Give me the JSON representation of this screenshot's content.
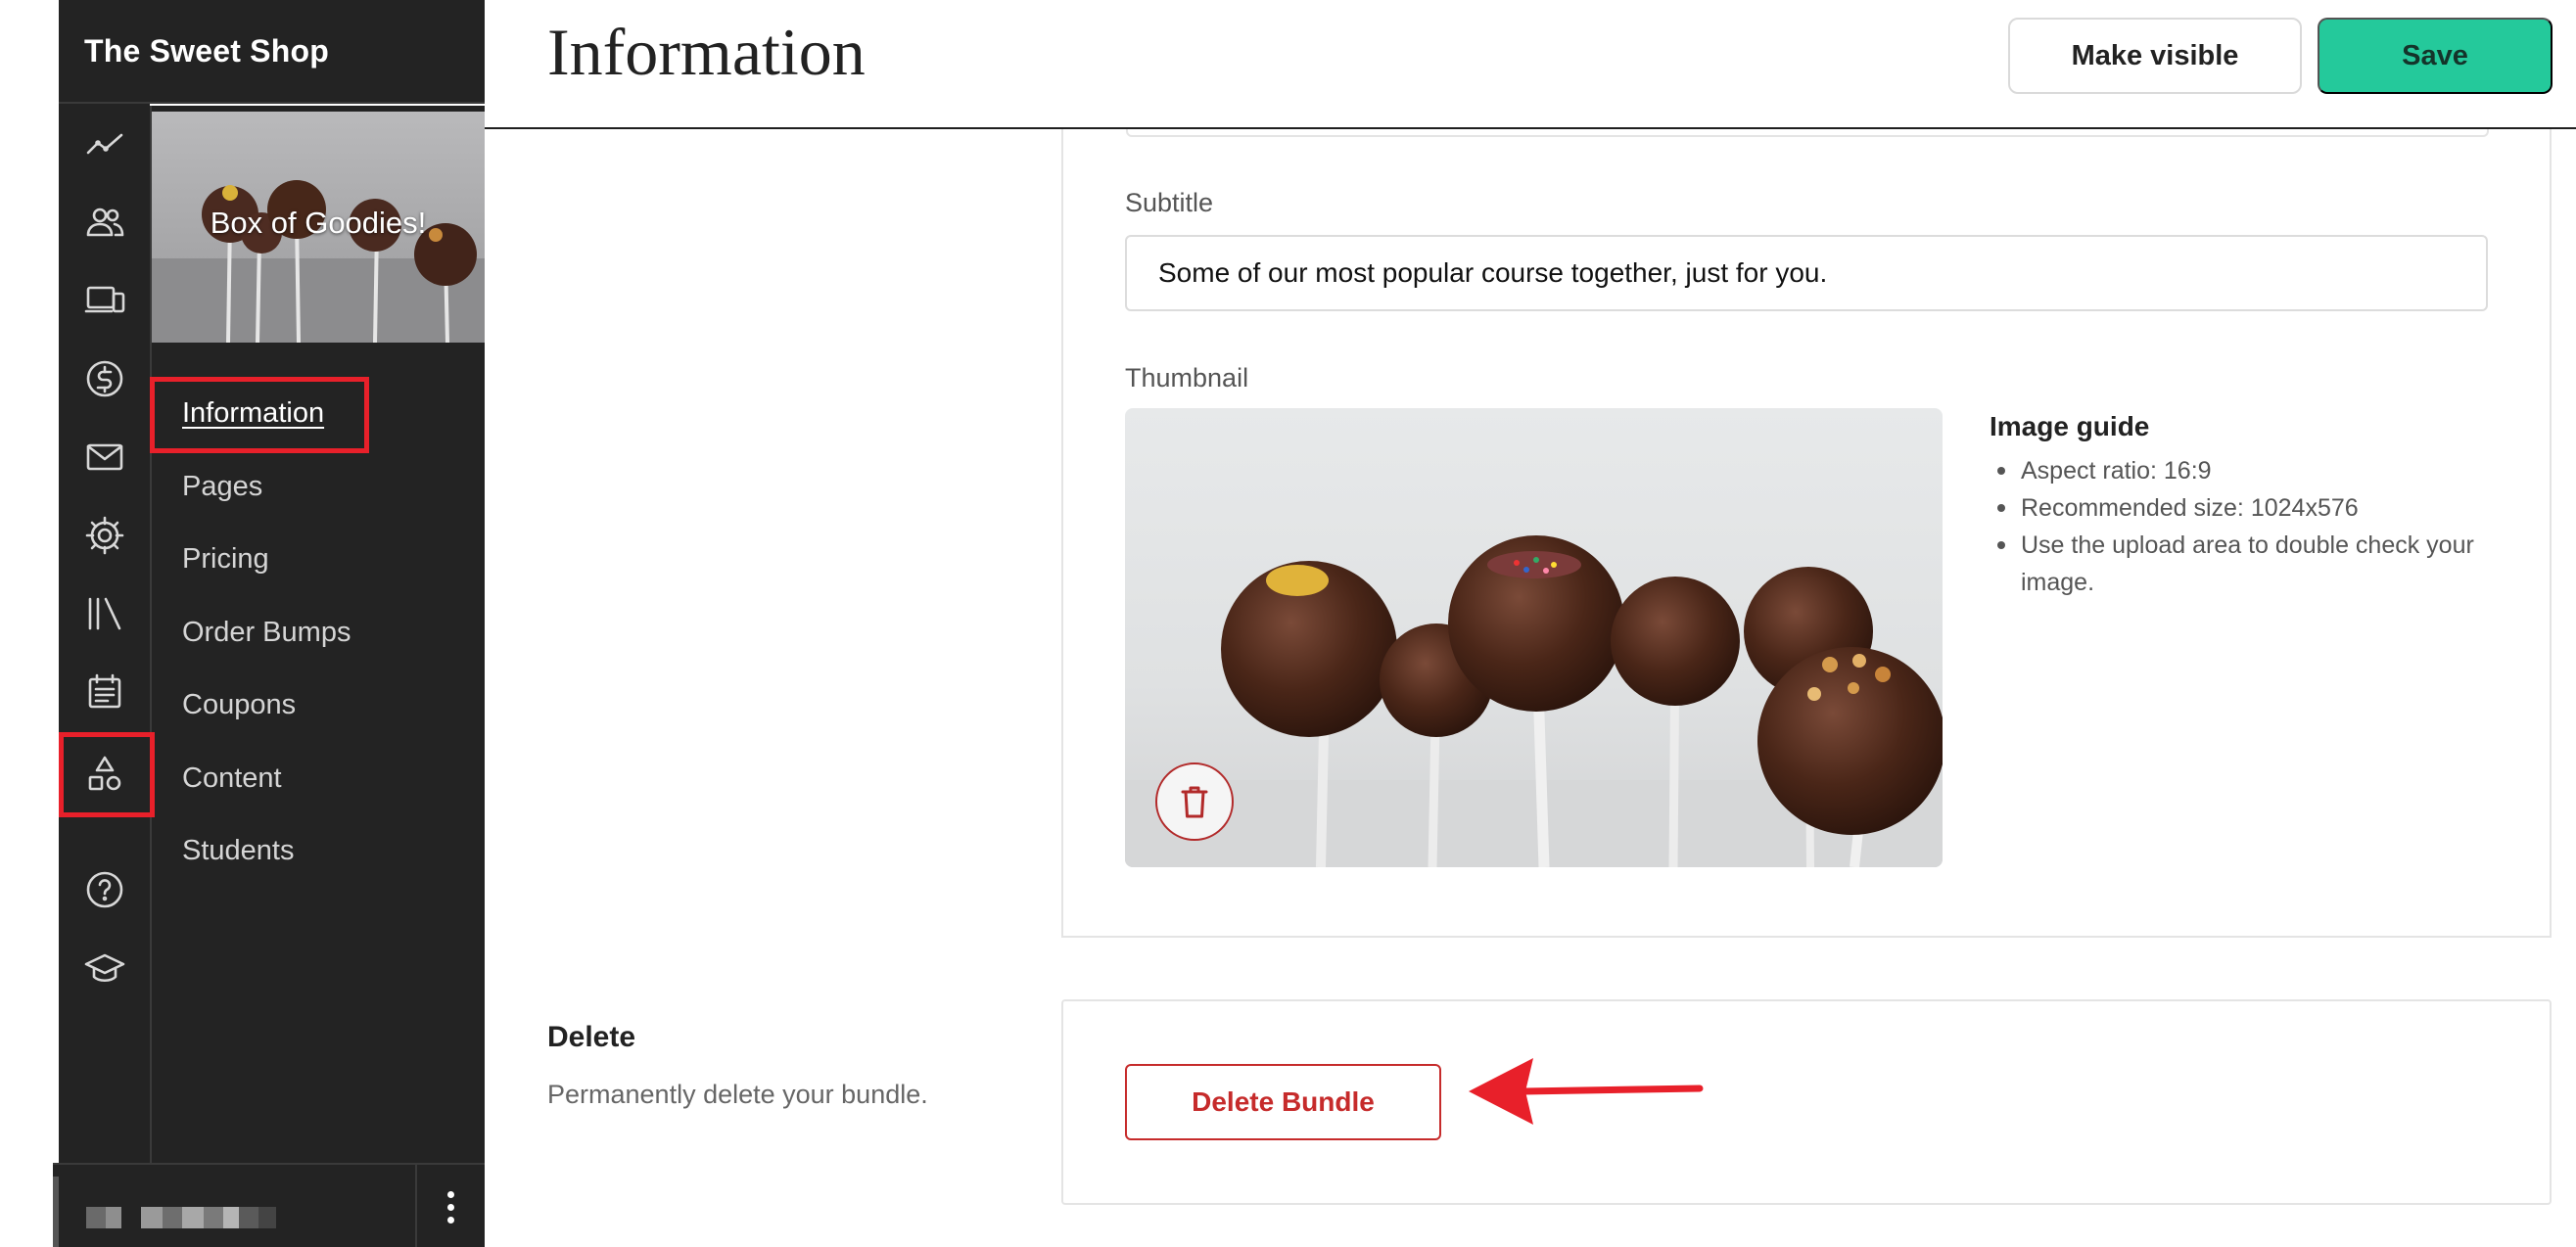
{
  "app": {
    "shop_name": "The Sweet Shop"
  },
  "rail": {
    "icons": [
      "analytics-icon",
      "users-icon",
      "devices-icon",
      "dollar-icon",
      "mail-icon",
      "gear-icon",
      "library-icon",
      "calendar-icon",
      "shapes-icon",
      "help-icon",
      "graduation-cap-icon"
    ],
    "active": "shapes-icon"
  },
  "bundle": {
    "title": "Box of Goodies!"
  },
  "subnav": {
    "items": [
      {
        "label": "Information",
        "active": true
      },
      {
        "label": "Pages"
      },
      {
        "label": "Pricing"
      },
      {
        "label": "Order Bumps"
      },
      {
        "label": "Coupons"
      },
      {
        "label": "Content"
      },
      {
        "label": "Students"
      }
    ]
  },
  "header": {
    "title": "Information",
    "make_visible_label": "Make visible",
    "save_label": "Save"
  },
  "form": {
    "subtitle_label": "Subtitle",
    "subtitle_value": "Some of our most popular course together, just for you.",
    "thumbnail_label": "Thumbnail",
    "thumbnail_icon": "trash-icon",
    "image_guide": {
      "title": "Image guide",
      "items": [
        "Aspect ratio: 16:9",
        "Recommended size: 1024x576",
        "Use the upload area to double check your image."
      ]
    }
  },
  "delete_section": {
    "heading": "Delete",
    "description": "Permanently delete your bundle.",
    "button_label": "Delete Bundle"
  },
  "annotations": {
    "highlight_color": "#e8202a"
  },
  "colors": {
    "accent_green": "#24c99b",
    "danger": "#c62b2b",
    "sidebar_bg": "#232323"
  }
}
